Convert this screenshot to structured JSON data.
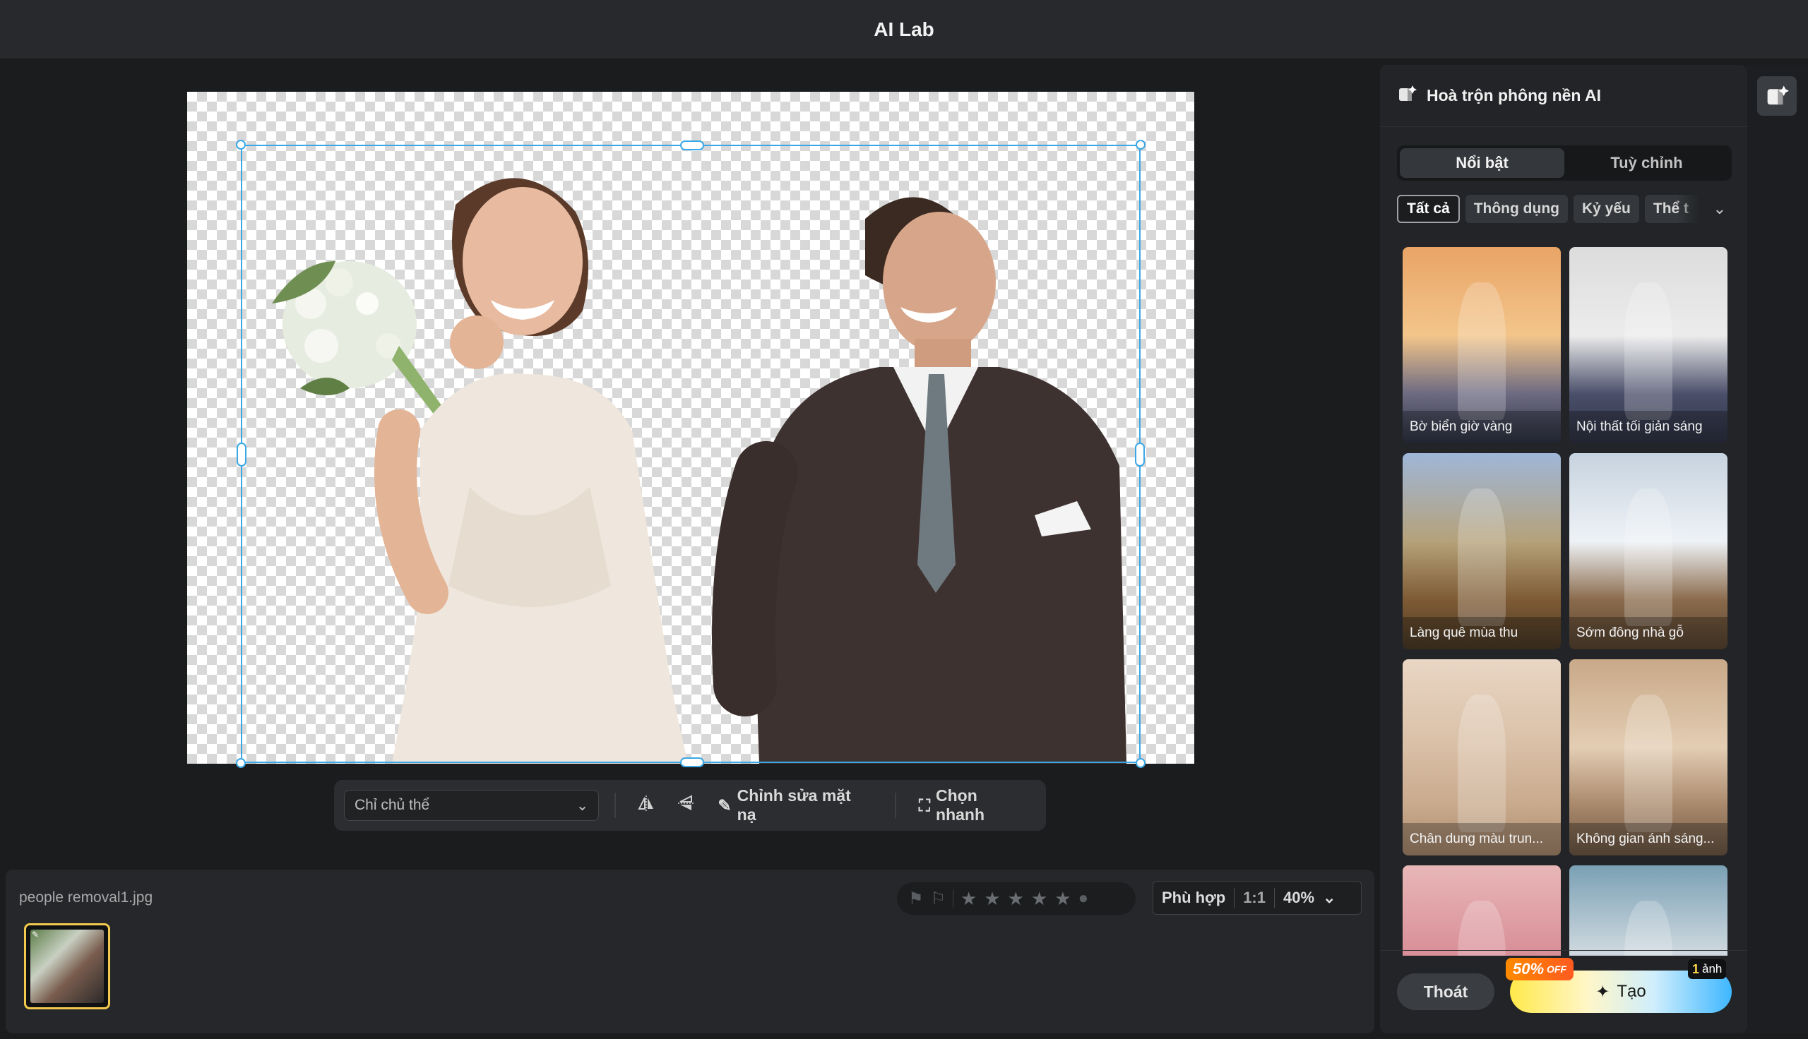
{
  "app": {
    "title": "AI Lab"
  },
  "toolbar": {
    "mode_select": "Chỉ chủ thể",
    "edit_mask": "Chỉnh sửa mặt nạ",
    "quick_select": "Chọn nhanh"
  },
  "filmstrip": {
    "filename": "people removal1.jpg"
  },
  "rating": {
    "stars": 0,
    "max_stars": 5
  },
  "zoom": {
    "fit": "Phù hợp",
    "one_to_one": "1:1",
    "level": "40%"
  },
  "panel": {
    "title": "Hoà trộn phông nền AI",
    "tabs": [
      "Nổi bật",
      "Tuỳ chỉnh"
    ],
    "active_tab": 0,
    "chips": [
      "Tất cả",
      "Thông dụng",
      "Kỷ yếu",
      "Thể t"
    ],
    "active_chip": 0,
    "presets": [
      {
        "label": "Bờ biển giờ vàng",
        "colors": [
          "#e9a466",
          "#f3c58a",
          "#6c6a82",
          "#2e3344"
        ]
      },
      {
        "label": "Nội thất tối giản sáng",
        "colors": [
          "#dcdcdc",
          "#ececec",
          "#4a4f6a",
          "#2f3244"
        ]
      },
      {
        "label": "Làng quê mùa thu",
        "colors": [
          "#9fb6d8",
          "#b5a27a",
          "#7e5a34",
          "#4a3b28"
        ]
      },
      {
        "label": "Sớm đông nhà gỗ",
        "colors": [
          "#c7d3df",
          "#eef2f6",
          "#8a6a4b",
          "#5a4632"
        ]
      },
      {
        "label": "Chân dung màu trun...",
        "colors": [
          "#e9d6c4",
          "#d9bfa6",
          "#c8a98c",
          "#a98a6e"
        ]
      },
      {
        "label": "Không gian ánh sáng...",
        "colors": [
          "#c9a988",
          "#e3cdb3",
          "#a8876a",
          "#6e5946"
        ]
      },
      {
        "label": "",
        "colors": [
          "#e8b7b7",
          "#d98f98",
          "#c77b86",
          "#b86b78"
        ]
      },
      {
        "label": "",
        "colors": [
          "#7aa0b5",
          "#cfd9df",
          "#3a4553",
          "#2a2f38"
        ]
      }
    ],
    "exit_label": "Thoát",
    "create_label": "Tạo",
    "promo_label": "50%",
    "promo_suffix": "OFF",
    "credit_count": "1",
    "credit_unit": "ảnh"
  }
}
